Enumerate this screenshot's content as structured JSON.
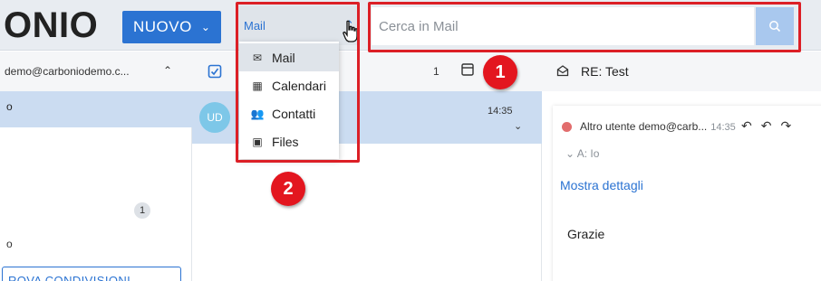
{
  "app": {
    "logo_text": "ONIO"
  },
  "toolbar": {
    "new_label": "NUOVO",
    "new_caret": "⌄"
  },
  "module_selector": {
    "current": "Mail",
    "chevron": "⌃"
  },
  "search": {
    "placeholder": "Cerca in Mail",
    "icon": "search-icon"
  },
  "dropdown": {
    "items": [
      {
        "icon": "✉",
        "label": "Mail"
      },
      {
        "icon": "▦",
        "label": "Calendari"
      },
      {
        "icon": "👥",
        "label": "Contatti"
      },
      {
        "icon": "▣",
        "label": "Files"
      }
    ]
  },
  "sidebar": {
    "account": "demo@carboniodemo.c...",
    "collapse": "⌃",
    "selected_folder": "o",
    "folder_badge": "1",
    "folder_item": "o",
    "share_button": "ROVA CONDIVISIONI"
  },
  "message_list": {
    "count": "1",
    "row": {
      "avatar": "UD",
      "time": "14:35",
      "chevron": "⌄"
    }
  },
  "reader": {
    "subject": "RE: Test",
    "sender": "Altro utente  demo@carb...",
    "time": "14:35",
    "to_line": "⌄  A: Io",
    "details_link": "Mostra dettagli",
    "body": "Grazie"
  },
  "annotations": {
    "step1": "1",
    "step2": "2"
  },
  "colors": {
    "accent": "#2b73d2",
    "highlight": "#dc1f26",
    "selection": "#cbdcf1"
  }
}
